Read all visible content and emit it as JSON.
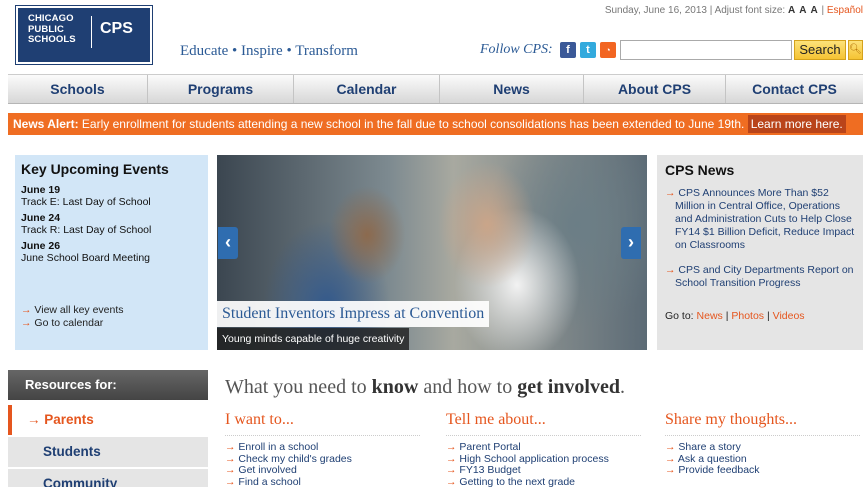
{
  "logo": {
    "line1": "CHICAGO",
    "line2": "PUBLIC",
    "line3": "SCHOOLS",
    "abbr": "CPS"
  },
  "topbar": {
    "date": "Sunday, June 16, 2013",
    "font_label": "Adjust font size:",
    "font_sizes": "A A A",
    "spanish": "Español"
  },
  "tagline": "Educate • Inspire • Transform",
  "follow": "Follow CPS:",
  "search": {
    "button": "Search",
    "placeholder": ""
  },
  "nav": [
    "Schools",
    "Programs",
    "Calendar",
    "News",
    "About CPS",
    "Contact CPS"
  ],
  "alert": {
    "prefix": "News Alert:",
    "text": "Early enrollment for students attending a new school in the fall due to school consolidations has been extended to June 19th.",
    "link": "Learn more here."
  },
  "events": {
    "title": "Key Upcoming Events",
    "items": [
      {
        "date": "June 19",
        "desc": "Track E: Last Day of School"
      },
      {
        "date": "June 24",
        "desc": "Track R: Last Day of School"
      },
      {
        "date": "June 26",
        "desc": "June School Board Meeting"
      }
    ],
    "links": [
      "View all key events",
      "Go to calendar"
    ]
  },
  "carousel": {
    "title": "Student Inventors Impress at Convention",
    "caption": "Young minds capable of huge creativity"
  },
  "news": {
    "title": "CPS News",
    "items": [
      "CPS Announces More Than $52 Million in Central Office, Operations and Administration Cuts to Help Close FY14 $1 Billion Deficit, Reduce Impact on Classrooms",
      "CPS and City Departments Report on School Transition Progress"
    ],
    "goto_label": "Go to:",
    "goto_links": [
      "News",
      "Photos",
      "Videos"
    ]
  },
  "resources": {
    "title": "Resources for:",
    "items": [
      "Parents",
      "Students",
      "Community"
    ]
  },
  "know": {
    "pre": "What you need to ",
    "b1": "know",
    "mid": " and how to ",
    "b2": "get involved",
    "post": "."
  },
  "columns": [
    {
      "title": "I want to...",
      "items": [
        "Enroll in a school",
        "Check my child's grades",
        "Get involved",
        "Find a school"
      ]
    },
    {
      "title": "Tell me about...",
      "items": [
        "Parent Portal",
        "High School application process",
        "FY13 Budget",
        "Getting to the next grade"
      ]
    },
    {
      "title": "Share my thoughts...",
      "items": [
        "Share a story",
        "Ask a question",
        "Provide feedback"
      ]
    }
  ]
}
